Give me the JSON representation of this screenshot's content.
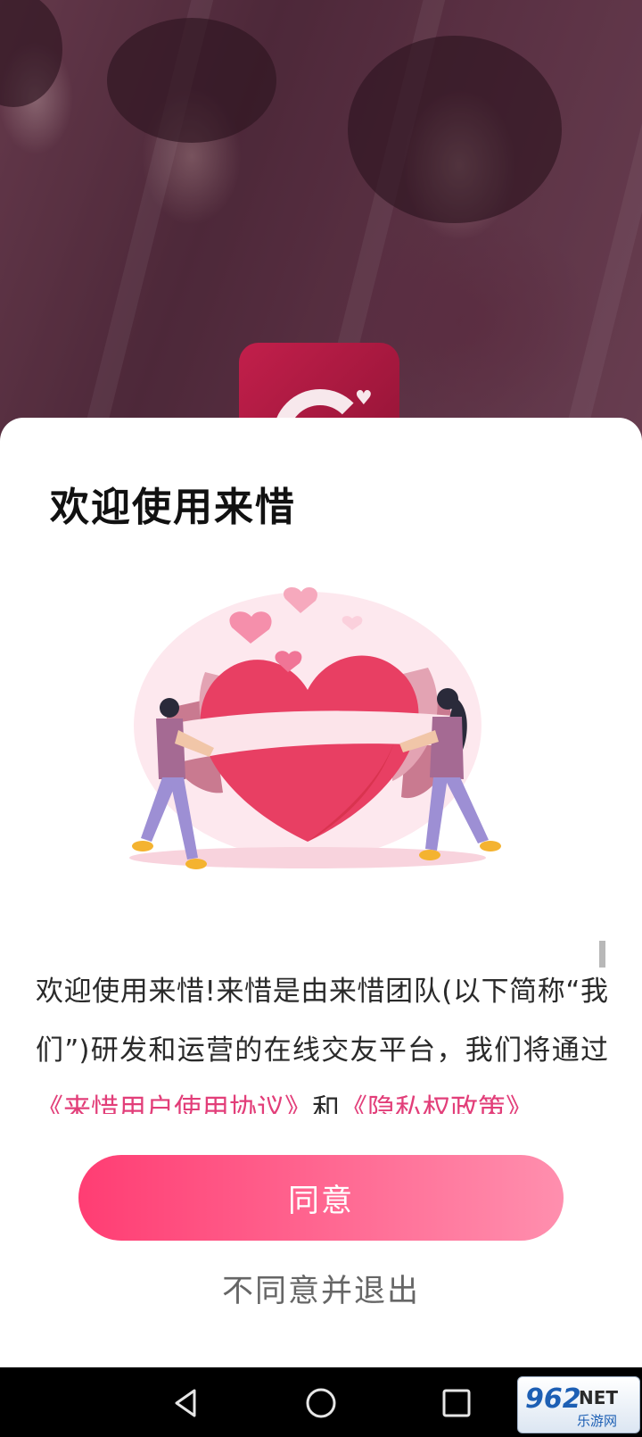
{
  "dialog": {
    "title": "欢迎使用来惜",
    "body": {
      "intro": "欢迎使用来惜!来惜是由来惜团队(以下简称“我们”)研发和运营的在线交友平台，我们将通过",
      "user_agreement_link": "《来惜用户使用协议》",
      "conjunction": "和",
      "privacy_policy_link": "《隐私权政策》"
    },
    "agree_label": "同意",
    "decline_label": "不同意并退出"
  },
  "watermark": {
    "brand": "962",
    "suffix": "NET",
    "caption": "乐游网"
  },
  "colors": {
    "accent_link": "#e23e79",
    "button_start": "#ff3d73",
    "button_end": "#ff8fae",
    "app_icon": "#c21f4b"
  },
  "icons": {
    "nav_back": "triangle-back-icon",
    "nav_home": "circle-home-icon",
    "nav_recents": "square-recents-icon"
  }
}
